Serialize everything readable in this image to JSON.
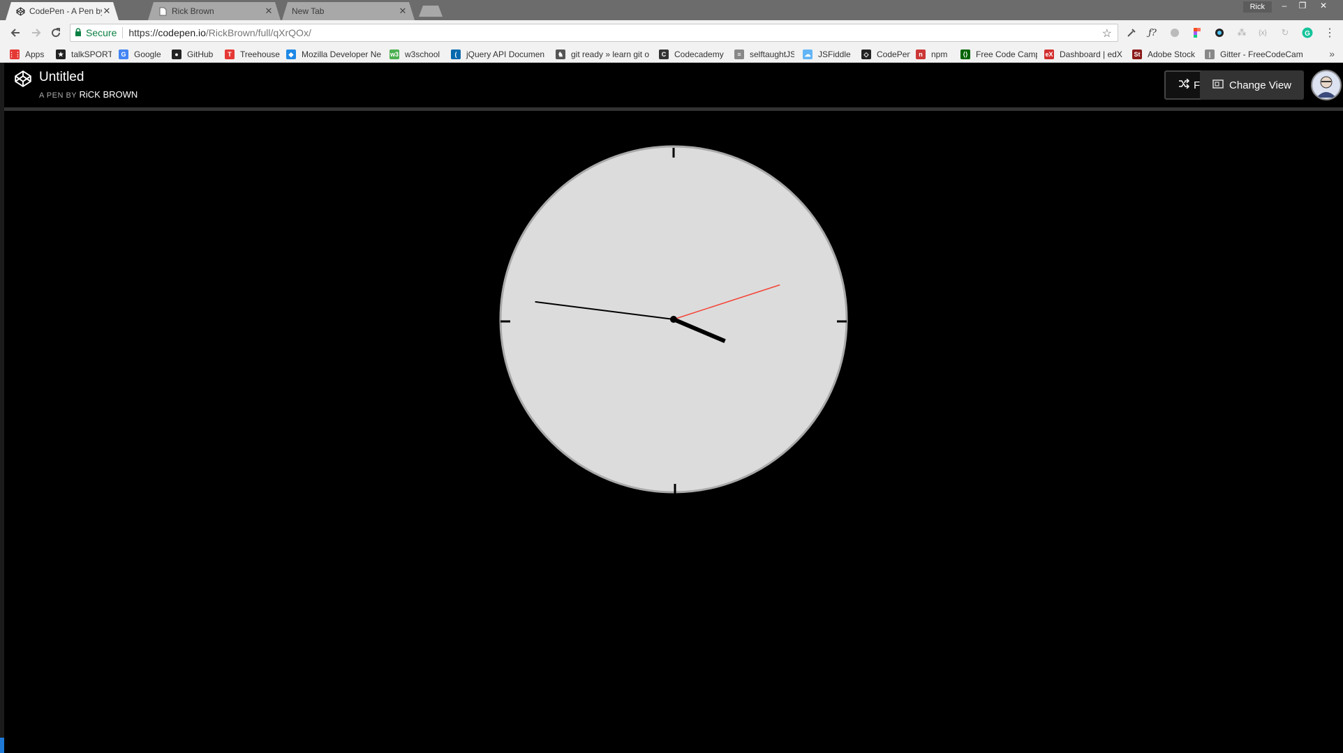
{
  "browser": {
    "tabs": [
      {
        "title": "CodePen - A Pen by RiCK",
        "active": true
      },
      {
        "title": "Rick Brown",
        "active": false
      },
      {
        "title": "New Tab",
        "active": false
      }
    ],
    "profile_name": "Rick",
    "window_controls": {
      "minimize": "–",
      "restore": "❐",
      "close": "✕"
    },
    "security_label": "Secure",
    "url_scheme": "https://",
    "url_host": "codepen.io",
    "url_path": "/RickBrown/full/qXrQOx/",
    "bookmarks": [
      {
        "label": "Apps",
        "icon": "apps-grid-icon",
        "color": "#e53935"
      },
      {
        "label": "talkSPORT",
        "icon": "talksport-icon",
        "color": "#222222"
      },
      {
        "label": "Google",
        "icon": "google-icon",
        "color": "#4285f4"
      },
      {
        "label": "GitHub",
        "icon": "github-icon",
        "color": "#222222"
      },
      {
        "label": "Treehouse",
        "icon": "treehouse-icon",
        "color": "#e53935"
      },
      {
        "label": "Mozilla Developer Ne",
        "icon": "mdn-icon",
        "color": "#1e88e5"
      },
      {
        "label": "w3school",
        "icon": "w3schools-icon",
        "color": "#4caf50"
      },
      {
        "label": "jQuery API Documen",
        "icon": "jquery-icon",
        "color": "#0769ad"
      },
      {
        "label": "git ready » learn git o",
        "icon": "gitready-icon",
        "color": "#555555"
      },
      {
        "label": "Codecademy",
        "icon": "codecademy-icon",
        "color": "#333333"
      },
      {
        "label": "selftaughtJS",
        "icon": "selftaughtjs-icon",
        "color": "#888888"
      },
      {
        "label": "JSFiddle",
        "icon": "jsfiddle-icon",
        "color": "#64b5f6"
      },
      {
        "label": "CodePen",
        "icon": "codepen-icon",
        "color": "#222222"
      },
      {
        "label": "npm",
        "icon": "npm-icon",
        "color": "#cb3837"
      },
      {
        "label": "Free Code Camp",
        "icon": "freecodecamp-icon",
        "color": "#006400"
      },
      {
        "label": "Dashboard | edX",
        "icon": "edx-icon",
        "color": "#d32f2f"
      },
      {
        "label": "Adobe Stock",
        "icon": "adobe-stock-icon",
        "color": "#8b1a1a"
      },
      {
        "label": "Gitter - FreeCodeCam",
        "icon": "gitter-icon",
        "color": "#888888"
      }
    ],
    "bookmarks_overflow": "»"
  },
  "codepen": {
    "pen_title": "Untitled",
    "byline_prefix": "A PEN BY",
    "author": "RiCK BROWN",
    "fork_label": "Fork",
    "change_view_label": "Change View"
  },
  "clock": {
    "face_color": "#dcdcdc",
    "rim_color": "#a9a9a9",
    "second_hand_color": "#f44336",
    "hand_color": "#000000",
    "time_shown": {
      "hour": 3,
      "minute": 46,
      "second": 12
    }
  }
}
